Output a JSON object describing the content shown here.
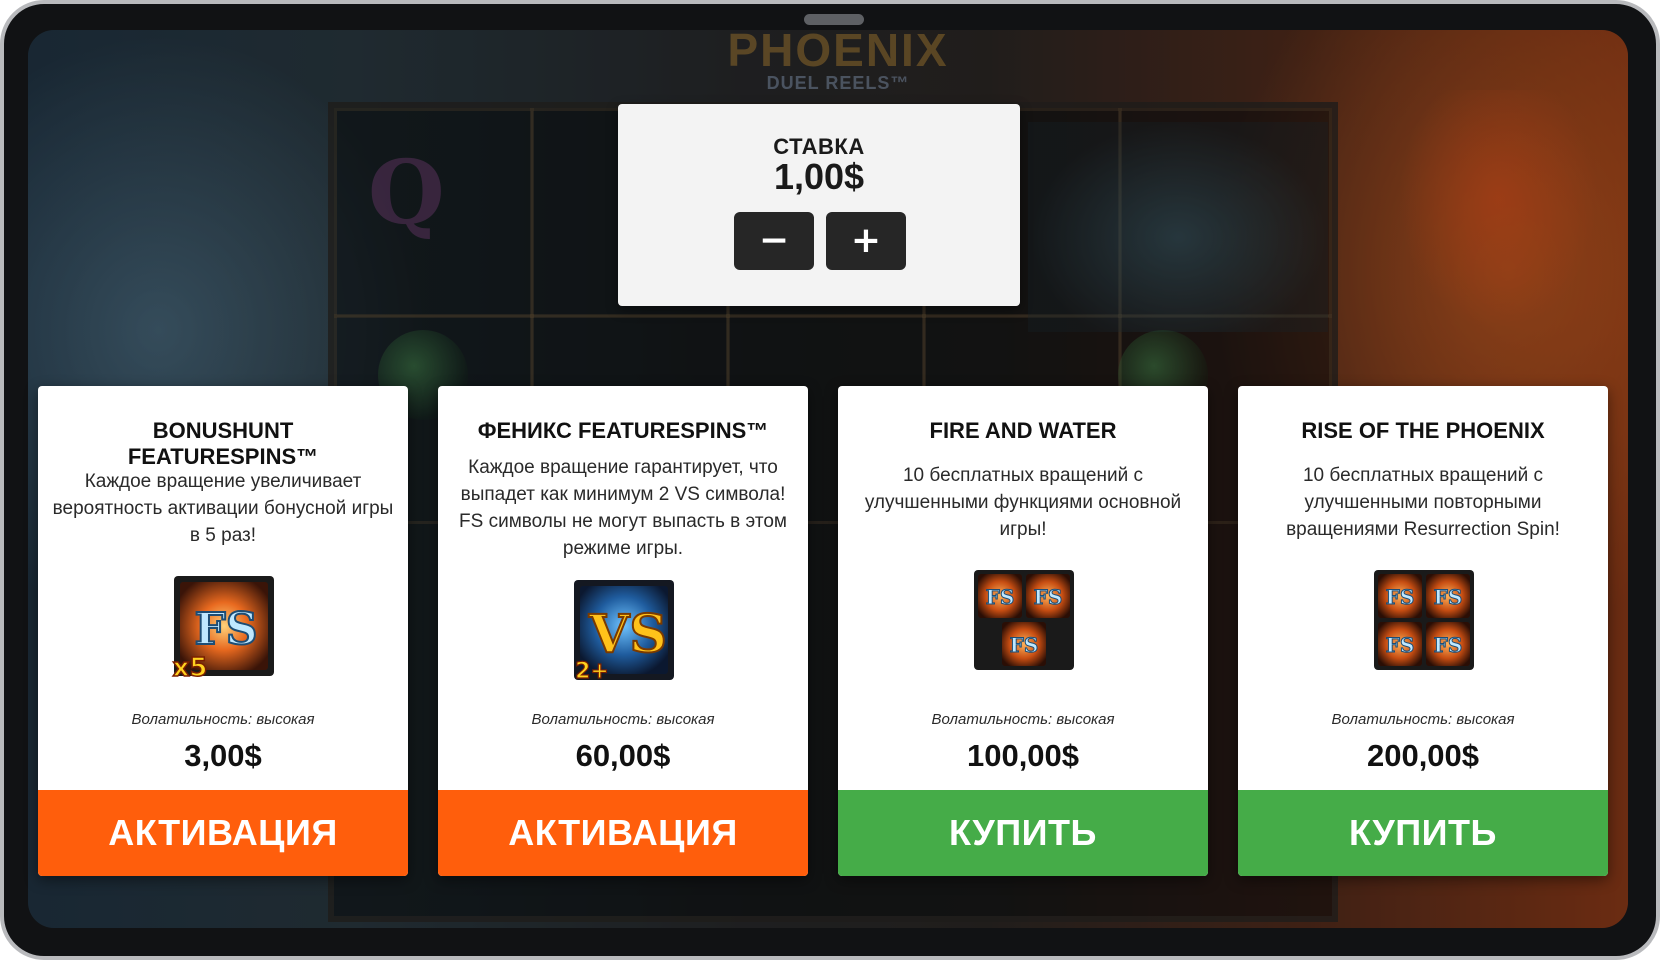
{
  "background": {
    "logo_word": "PHOENIX",
    "logo_sub": "DUEL REELS™",
    "reel_letter": "Q"
  },
  "bet": {
    "label": "СТАВКА",
    "value": "1,00$",
    "minus_label": "−",
    "plus_label": "+"
  },
  "colors": {
    "activate_button": "#ff5e0c",
    "buy_button": "#45ac48",
    "bet_button": "#262626"
  },
  "cards": [
    {
      "title": "BONUSHUNT FEATURESPINS™",
      "title_lines": [
        "BONUSHUNT",
        "FEATURESPINS™"
      ],
      "description": "Каждое вращение увеличивает вероятность активации бонусной игры в 5 раз!",
      "icon": "fs-x5-icon",
      "icon_text": "FS",
      "icon_badge": "x5",
      "volatility": "Волатильность: высокая",
      "price": "3,00$",
      "button": "АКТИВАЦИЯ",
      "button_type": "activate"
    },
    {
      "title": "ФЕНИКС FEATURESPINS™",
      "description": "Каждое вращение гарантирует, что выпадет как минимум 2 VS символа! FS символы не могут выпасть в этом режиме игры.",
      "icon": "vs-2plus-icon",
      "icon_text": "VS",
      "icon_badge": "2+",
      "volatility": "Волатильность: высокая",
      "price": "60,00$",
      "button": "АКТИВАЦИЯ",
      "button_type": "activate"
    },
    {
      "title": "FIRE AND WATER",
      "description": "10 бесплатных вращений с улучшенными функциями основной игры!",
      "icon": "fs-three-icon",
      "icon_text": "FS",
      "volatility": "Волатильность: высокая",
      "price": "100,00$",
      "button": "КУПИТЬ",
      "button_type": "buy"
    },
    {
      "title": "RISE OF THE PHOENIX",
      "description": "10 бесплатных вращений с улучшенными повторными вращениями Resurrection Spin!",
      "icon": "fs-four-icon",
      "icon_text": "FS",
      "volatility": "Волатильность: высокая",
      "price": "200,00$",
      "button": "КУПИТЬ",
      "button_type": "buy"
    }
  ]
}
